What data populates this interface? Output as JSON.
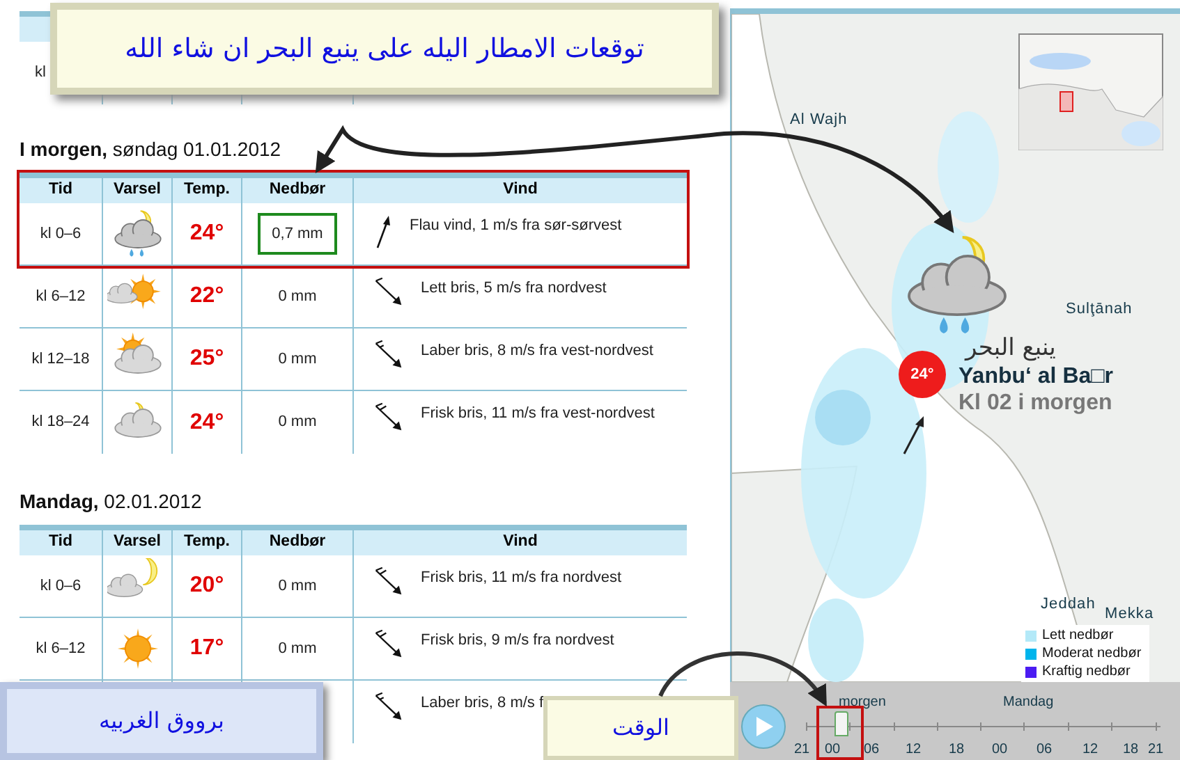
{
  "banner": {
    "text": "توقعات الامطار اليله على ينبع البحر ان شاء الله"
  },
  "earlier_table": {
    "outlined": false,
    "rows": [
      {
        "time": "kl"
      }
    ]
  },
  "days": [
    {
      "title_bold": "I morgen,",
      "title_rest": "søndag 01.01.2012",
      "outlined": true,
      "columns": [
        "Tid",
        "Varsel",
        "Temp.",
        "Nedbør",
        "Vind"
      ],
      "rows": [
        {
          "time": "kl 0–6",
          "temp": "24°",
          "precip": "0,7 mm",
          "precip_boxed": true,
          "wind": "Flau vind, 1 m/s fra sør-sørvest"
        },
        {
          "time": "kl 6–12",
          "temp": "22°",
          "precip": "0 mm",
          "precip_boxed": false,
          "wind": "Lett bris, 5 m/s fra nordvest"
        },
        {
          "time": "kl 12–18",
          "temp": "25°",
          "precip": "0 mm",
          "precip_boxed": false,
          "wind": "Laber bris, 8 m/s fra vest-nordvest"
        },
        {
          "time": "kl 18–24",
          "temp": "24°",
          "precip": "0 mm",
          "precip_boxed": false,
          "wind": "Frisk bris, 11 m/s fra vest-nordvest"
        }
      ]
    },
    {
      "title_bold": "Mandag,",
      "title_rest": "02.01.2012",
      "outlined": false,
      "columns": [
        "Tid",
        "Varsel",
        "Temp.",
        "Nedbør",
        "Vind"
      ],
      "rows": [
        {
          "time": "kl 0–6",
          "temp": "20°",
          "precip": "0 mm",
          "precip_boxed": false,
          "wind": "Frisk bris, 11 m/s fra nordvest"
        },
        {
          "time": "kl 6–12",
          "temp": "17°",
          "precip": "0 mm",
          "precip_boxed": false,
          "wind": "Frisk bris, 9 m/s fra nordvest"
        },
        {
          "wind": "Laber bris, 8 m/s f"
        }
      ]
    }
  ],
  "map": {
    "places": [
      "Al Wajh",
      "Sulţānah",
      "Jeddah",
      "Mekka"
    ],
    "forecast": {
      "name_local": "ينبع البحر",
      "temp": "24°",
      "name": "Yanbu‘ al Ba□r",
      "time": "Kl 02 i morgen"
    },
    "legend": [
      {
        "label": "Lett nedbør",
        "color": "#b3e9f8"
      },
      {
        "label": "Moderat nedbør",
        "color": "#00b4ec"
      },
      {
        "label": "Kraftig nedbør",
        "color": "#4b1cf2"
      }
    ],
    "timeline": {
      "days": [
        "morgen",
        "Mandag"
      ],
      "ticks": [
        "21",
        "00",
        "06",
        "12",
        "18",
        "00",
        "06",
        "12",
        "18",
        "21"
      ],
      "level": 0.1
    }
  },
  "notes": {
    "region": "برووق الغربيه",
    "time": "الوقت"
  }
}
